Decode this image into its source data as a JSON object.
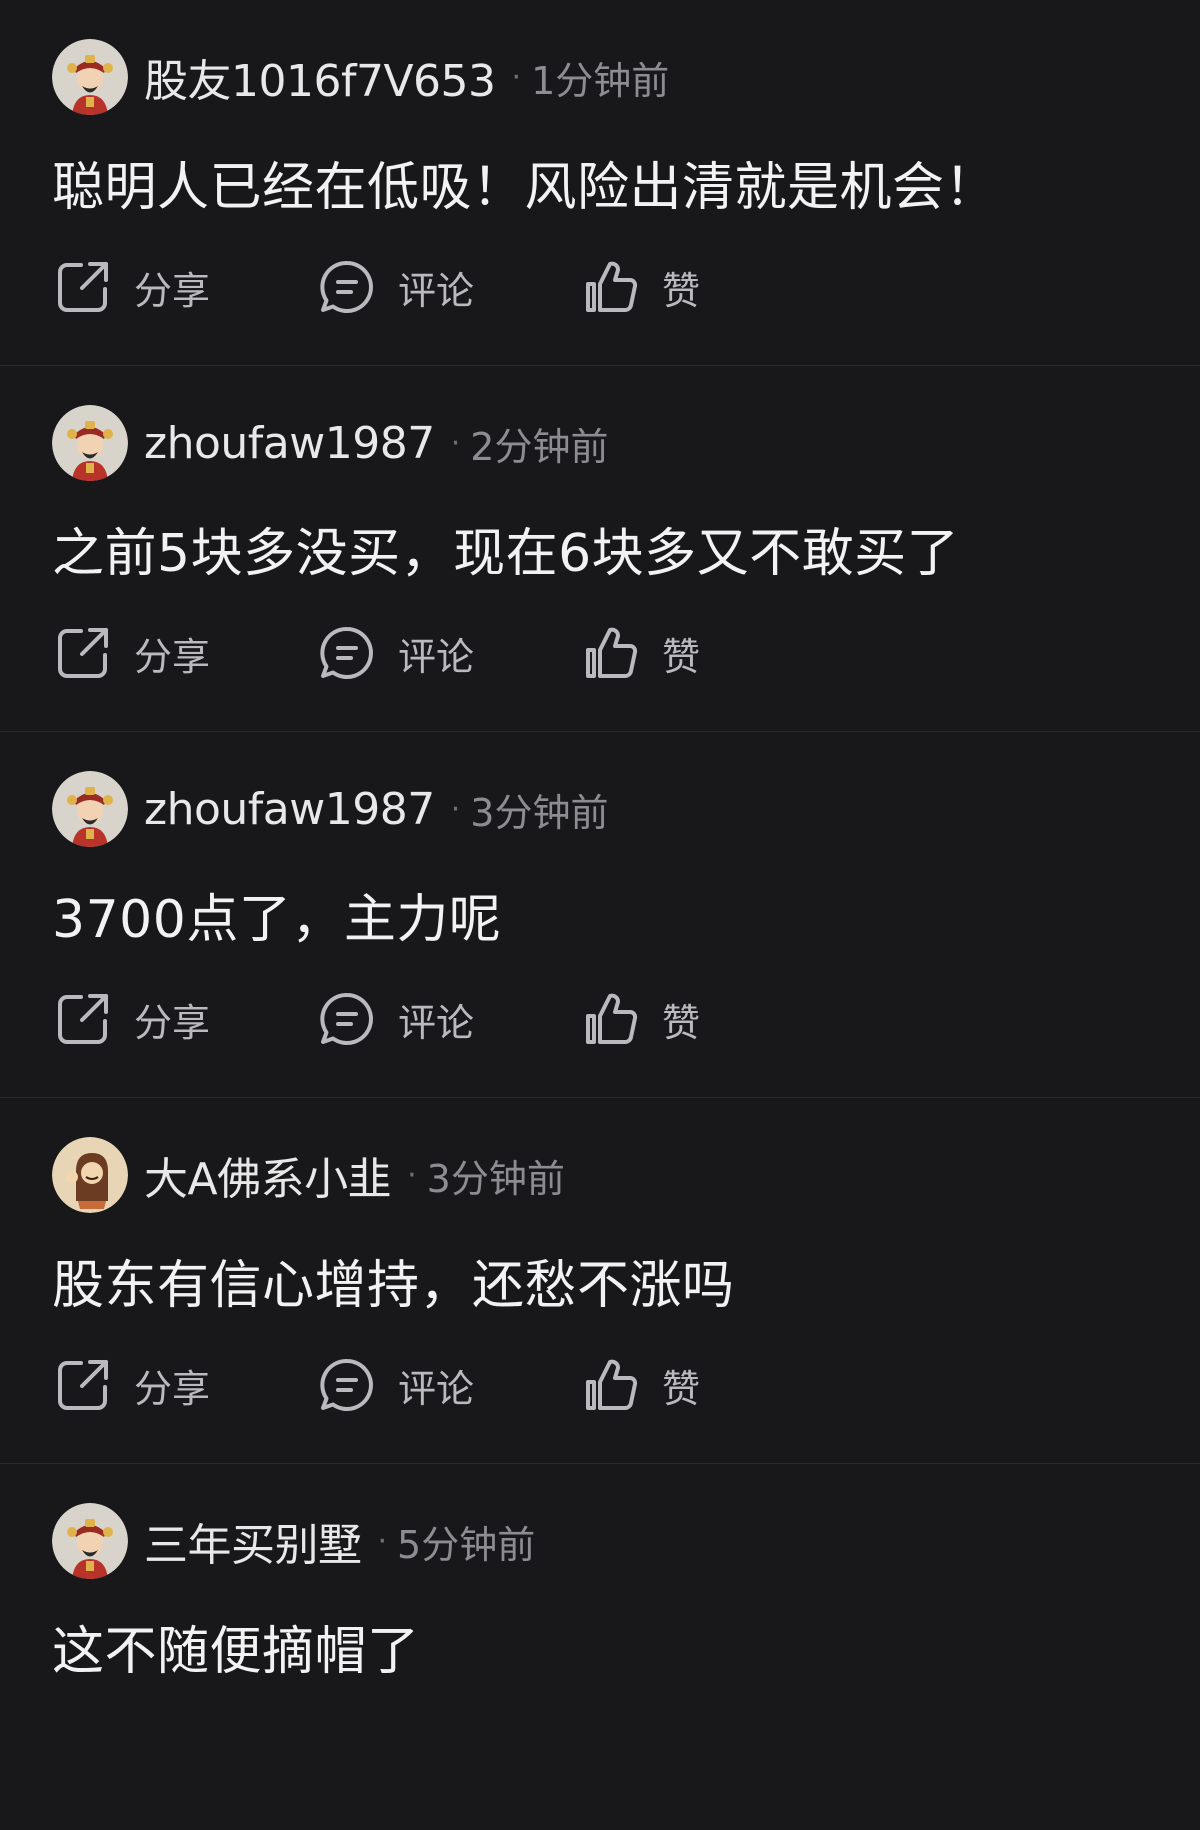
{
  "actions": {
    "share": "分享",
    "comment": "评论",
    "like": "赞"
  },
  "comments": [
    {
      "username": "股友1016f7V653",
      "time": "1分钟前",
      "text": "聪明人已经在低吸！风险出清就是机会！",
      "avatar": "fortune-god-avatar"
    },
    {
      "username": "zhoufaw1987",
      "time": "2分钟前",
      "text": "之前5块多没买，现在6块多又不敢买了",
      "avatar": "fortune-god-avatar"
    },
    {
      "username": "zhoufaw1987",
      "time": "3分钟前",
      "text": "3700点了，主力呢",
      "avatar": "fortune-god-avatar"
    },
    {
      "username": "大A佛系小韭",
      "time": "3分钟前",
      "text": "股东有信心增持，还愁不涨吗",
      "avatar": "cartoon-character-avatar"
    },
    {
      "username": "三年买别墅",
      "time": "5分钟前",
      "text": "这不随便摘帽了",
      "avatar": "fortune-god-avatar"
    }
  ],
  "colors": {
    "background": "#18181a",
    "divider": "#2b2b2e",
    "username": "#e8e8e8",
    "time": "#8c8c91",
    "action_label": "#b9b9be"
  }
}
